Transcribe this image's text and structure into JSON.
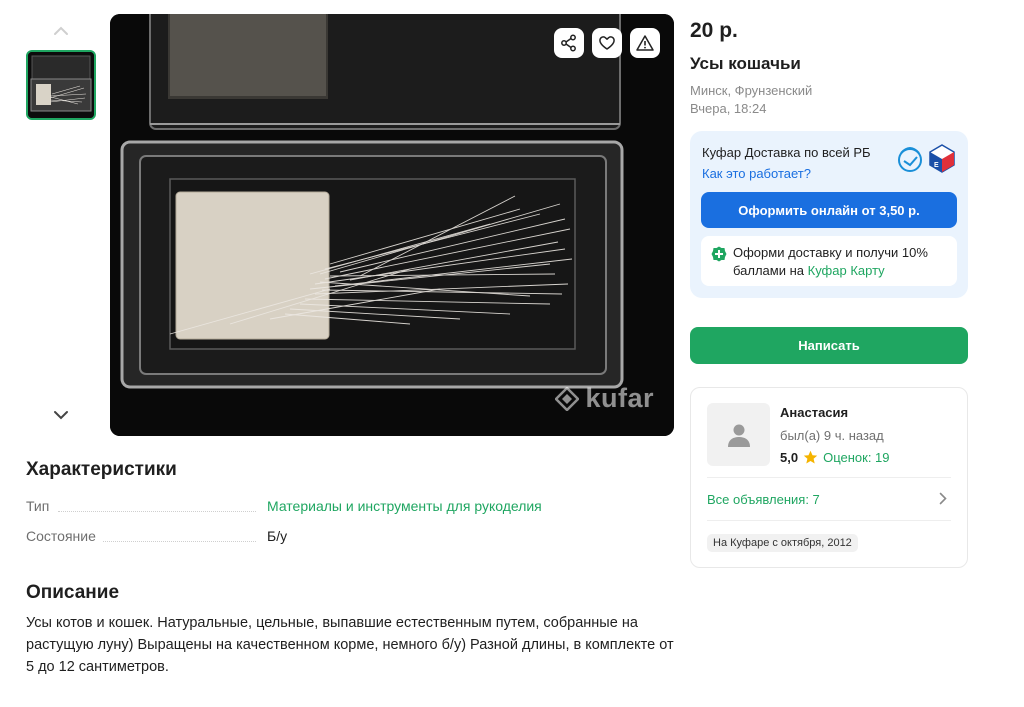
{
  "gallery": {
    "watermark": "kufar",
    "icons": {
      "share": "share-icon",
      "favorite": "heart-icon",
      "report": "warning-icon",
      "up": "chevron-up-icon",
      "down": "chevron-down-icon"
    }
  },
  "listing": {
    "price": "20 р.",
    "title": "Усы кошачьи",
    "location": "Минск, Фрунзенский",
    "time": "Вчера, 18:24"
  },
  "characteristics": {
    "heading": "Характеристики",
    "rows": [
      {
        "label": "Тип",
        "value": "Материалы и инструменты для рукоделия"
      },
      {
        "label": "Состояние",
        "value": "Б/у"
      }
    ]
  },
  "description": {
    "heading": "Описание",
    "text": "Усы котов и кошек. Натуральные, цельные, выпавшие естественным путем, собранные на растущую луну) Выращены на качественном корме, немного б/у) Разной длины, в комплекте от 5 до 12 сантиметров."
  },
  "delivery": {
    "title": "Куфар Доставка по всей РБ",
    "how_link": "Как это работает?",
    "order_button": "Оформить онлайн от 3,50 р.",
    "promo_text": "Оформи доставку и получи 10% баллами на ",
    "promo_link": "Куфар Карту"
  },
  "contact": {
    "write_button": "Написать"
  },
  "seller": {
    "name": "Анастасия",
    "last_seen": "был(а) 9 ч. назад",
    "rating": "5,0",
    "reviews": "Оценок: 19",
    "all_ads": "Все объявления: 7",
    "since": "На Куфаре с октября, 2012"
  },
  "colors": {
    "accent_green": "#1fa661",
    "accent_blue": "#1a6fe0",
    "delivery_bg": "#eaf3fd",
    "star": "#f5b400"
  }
}
